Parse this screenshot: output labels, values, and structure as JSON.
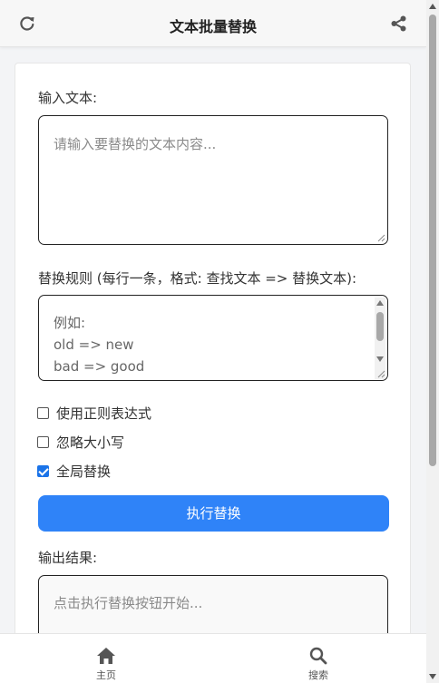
{
  "header": {
    "title": "文本批量替换",
    "left_icon": "refresh-icon",
    "right_icon": "share-icon"
  },
  "input_section": {
    "label": "输入文本:",
    "placeholder": "请输入要替换的文本内容..."
  },
  "rules_section": {
    "label": "替换规则 (每行一条，格式: 查找文本 => 替换文本):",
    "lines": [
      "例如:",
      "old => new",
      "bad => good"
    ]
  },
  "options": [
    {
      "label": "使用正则表达式",
      "checked": false
    },
    {
      "label": "忽略大小写",
      "checked": false
    },
    {
      "label": "全局替换",
      "checked": true
    }
  ],
  "execute_button": {
    "label": "执行替换"
  },
  "output_section": {
    "label": "输出结果:",
    "placeholder": "点击执行替换按钮开始..."
  },
  "bottom_nav": [
    {
      "label": "主页",
      "icon": "home-icon"
    },
    {
      "label": "搜索",
      "icon": "search-icon"
    }
  ],
  "colors": {
    "accent": "#2f83f8",
    "checkbox": "#1a73e8",
    "icon": "#555555"
  }
}
